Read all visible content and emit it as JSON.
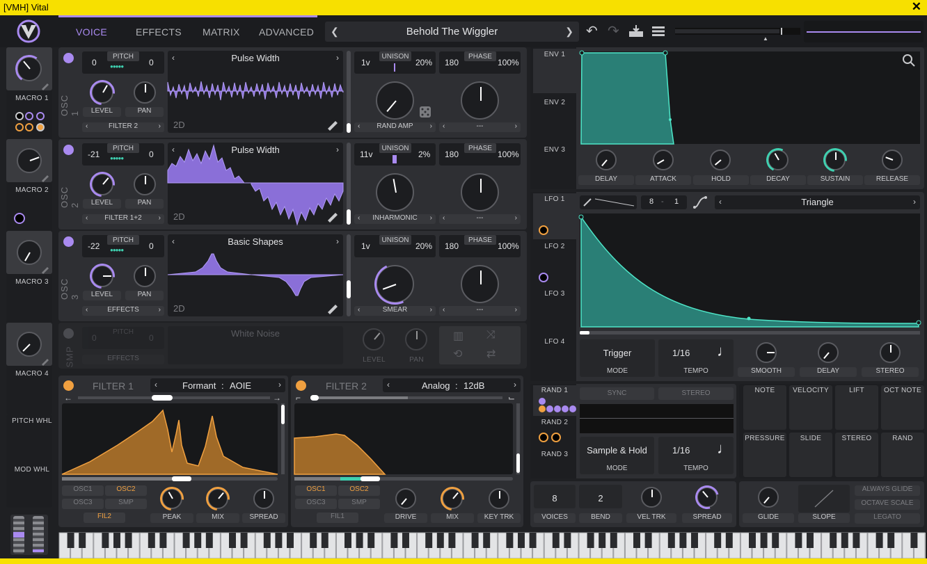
{
  "window": {
    "title": "[VMH] Vital",
    "close": "✕"
  },
  "tabs": [
    "VOICE",
    "EFFECTS",
    "MATRIX",
    "ADVANCED"
  ],
  "preset": {
    "name": "Behold The Wiggler"
  },
  "macros": [
    "MACRO 1",
    "MACRO 2",
    "MACRO 3",
    "MACRO 4"
  ],
  "wheels": [
    "PITCH WHL",
    "MOD WHL"
  ],
  "oscillators": [
    {
      "label": "OSC 1",
      "pitch_label": "PITCH",
      "pitch_left": "0",
      "pitch_right": "0",
      "wave": "Pulse Width",
      "dim": "2D",
      "unison_label": "UNISON",
      "voices": "1v",
      "detune": "20%",
      "phase_label": "PHASE",
      "phase": "180",
      "phase_pct": "100%",
      "warp": "RAND AMP",
      "warp2": "---",
      "dest": "FILTER 2",
      "level": "LEVEL",
      "pan": "PAN"
    },
    {
      "label": "OSC 2",
      "pitch_label": "PITCH",
      "pitch_left": "-21",
      "pitch_right": "0",
      "wave": "Pulse Width",
      "dim": "2D",
      "unison_label": "UNISON",
      "voices": "11v",
      "detune": "2%",
      "phase_label": "PHASE",
      "phase": "180",
      "phase_pct": "100%",
      "warp": "INHARMONIC",
      "warp2": "---",
      "dest": "FILTER 1+2",
      "level": "LEVEL",
      "pan": "PAN"
    },
    {
      "label": "OSC 3",
      "pitch_label": "PITCH",
      "pitch_left": "-22",
      "pitch_right": "0",
      "wave": "Basic Shapes",
      "dim": "2D",
      "unison_label": "UNISON",
      "voices": "1v",
      "detune": "20%",
      "phase_label": "PHASE",
      "phase": "180",
      "phase_pct": "100%",
      "warp": "SMEAR",
      "warp2": "---",
      "dest": "EFFECTS",
      "level": "LEVEL",
      "pan": "PAN"
    }
  ],
  "sampler": {
    "label": "SMP",
    "pitch_label": "PITCH",
    "pitch_left": "0",
    "pitch_right": "0",
    "sample": "White Noise",
    "dest": "EFFECTS",
    "level": "LEVEL",
    "pan": "PAN"
  },
  "filter1": {
    "title": "FILTER 1",
    "type": "Formant",
    "subtype": "AOIE",
    "sep": ":",
    "sources": [
      "OSC1",
      "OSC2",
      "OSC3",
      "SMP",
      "FIL2"
    ],
    "knobs": [
      "PEAK",
      "MIX",
      "SPREAD"
    ]
  },
  "filter2": {
    "title": "FILTER 2",
    "type": "Analog",
    "subtype": "12dB",
    "sep": ":",
    "sources": [
      "OSC1",
      "OSC2",
      "OSC3",
      "SMP",
      "FIL1"
    ],
    "knobs": [
      "DRIVE",
      "MIX",
      "KEY TRK"
    ]
  },
  "envelopes": {
    "tabs": [
      "ENV 1",
      "ENV 2",
      "ENV 3"
    ],
    "knobs": [
      "DELAY",
      "ATTACK",
      "HOLD",
      "DECAY",
      "SUSTAIN",
      "RELEASE"
    ]
  },
  "lfos": {
    "tabs": [
      "LFO 1",
      "LFO 2",
      "LFO 3",
      "LFO 4"
    ],
    "grid_x": "8",
    "grid_sep": "-",
    "grid_y": "1",
    "shape": "Triangle",
    "mode": "Trigger",
    "mode_label": "MODE",
    "tempo": "1/16",
    "tempo_label": "TEMPO",
    "knobs": [
      "SMOOTH",
      "DELAY",
      "STEREO"
    ]
  },
  "randoms": {
    "tabs": [
      "RAND 1",
      "RAND 2",
      "RAND 3"
    ],
    "sync": "SYNC",
    "stereo": "STEREO",
    "mode": "Sample & Hold",
    "mode_label": "MODE",
    "tempo": "1/16",
    "tempo_label": "TEMPO"
  },
  "mod_sources": [
    "NOTE",
    "VELOCITY",
    "LIFT",
    "OCT NOTE",
    "PRESSURE",
    "SLIDE",
    "STEREO",
    "RAND"
  ],
  "voice": {
    "voices": "8",
    "voices_label": "VOICES",
    "bend": "2",
    "bend_label": "BEND",
    "vel_trk": "VEL TRK",
    "spread": "SPREAD"
  },
  "glide": {
    "glide": "GLIDE",
    "slope": "SLOPE",
    "always_glide": "ALWAYS GLIDE",
    "octave_scale": "OCTAVE SCALE",
    "legato": "LEGATO"
  },
  "colors": {
    "accent": "#a98af0",
    "mod": "#3fd0b0",
    "filter": "#f0a040",
    "titlebar": "#f7e000"
  }
}
